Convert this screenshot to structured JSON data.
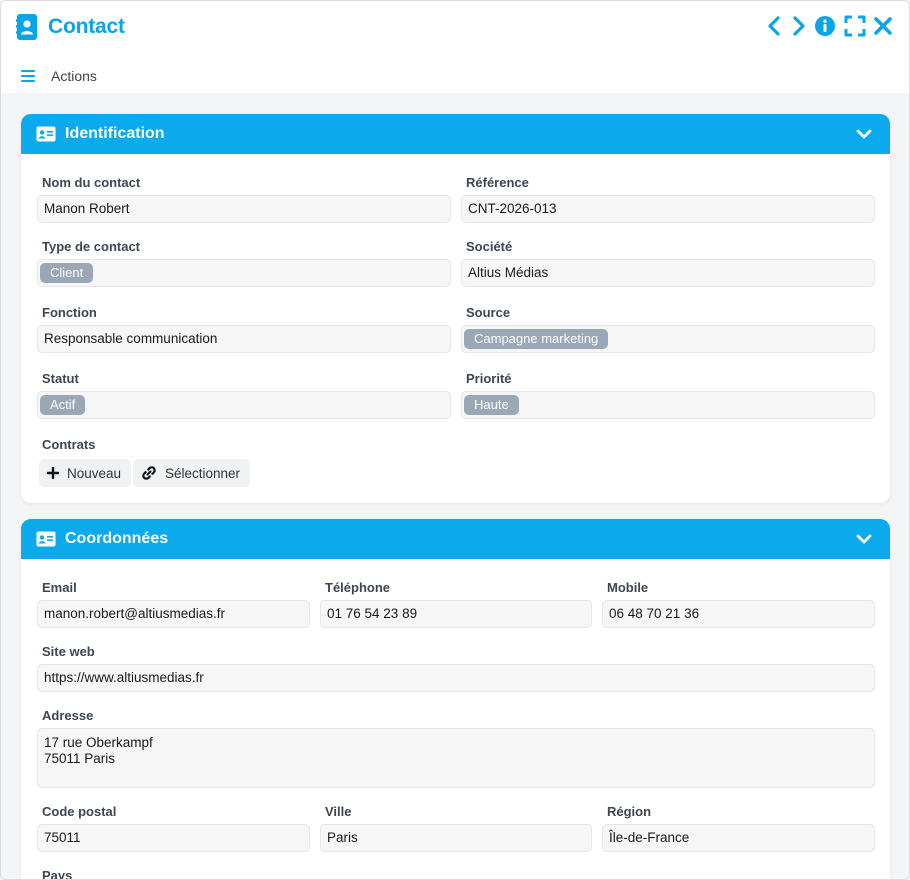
{
  "window": {
    "title": "Contact",
    "icons": [
      "contact-book-icon",
      "chevron-left-icon",
      "chevron-right-icon",
      "info-icon",
      "fullscreen-icon",
      "close-icon"
    ]
  },
  "actions": {
    "label": "Actions",
    "icon": "hamburger-icon"
  },
  "colors": {
    "accent": "#0aa4e8",
    "panel_header": "#0aaaed",
    "tag": "#9aa7b7"
  },
  "identification": {
    "title": "Identification",
    "icon": "id-card-icon",
    "fields": {
      "nom_du_contact": {
        "label": "Nom du contact",
        "value": "Manon Robert"
      },
      "reference": {
        "label": "Référence",
        "value": "CNT-2026-013"
      },
      "type_de_contact": {
        "label": "Type de contact",
        "value": "Client"
      },
      "societe": {
        "label": "Société",
        "value": "Altius Médias"
      },
      "fonction": {
        "label": "Fonction",
        "value": "Responsable communication"
      },
      "source": {
        "label": "Source",
        "value": "Campagne marketing"
      },
      "statut": {
        "label": "Statut",
        "value": "Actif"
      },
      "priorite": {
        "label": "Priorité",
        "value": "Haute"
      }
    },
    "contrats": {
      "label": "Contrats",
      "new_label": "Nouveau",
      "select_label": "Sélectionner"
    }
  },
  "coordonnees": {
    "title": "Coordonnées",
    "icon": "id-card-icon",
    "fields": {
      "email": {
        "label": "Email",
        "value": "manon.robert@altiusmedias.fr"
      },
      "telephone": {
        "label": "Téléphone",
        "value": "01 76 54 23 89"
      },
      "mobile": {
        "label": "Mobile",
        "value": "06 48 70 21 36"
      },
      "site_web": {
        "label": "Site web",
        "value": "https://www.altiusmedias.fr"
      },
      "adresse": {
        "label": "Adresse",
        "value": "17 rue Oberkampf\n75011 Paris"
      },
      "code_postal": {
        "label": "Code postal",
        "value": "75011"
      },
      "ville": {
        "label": "Ville",
        "value": "Paris"
      },
      "region": {
        "label": "Région",
        "value": "Île-de-France"
      },
      "pays": {
        "label": "Pays"
      }
    }
  }
}
